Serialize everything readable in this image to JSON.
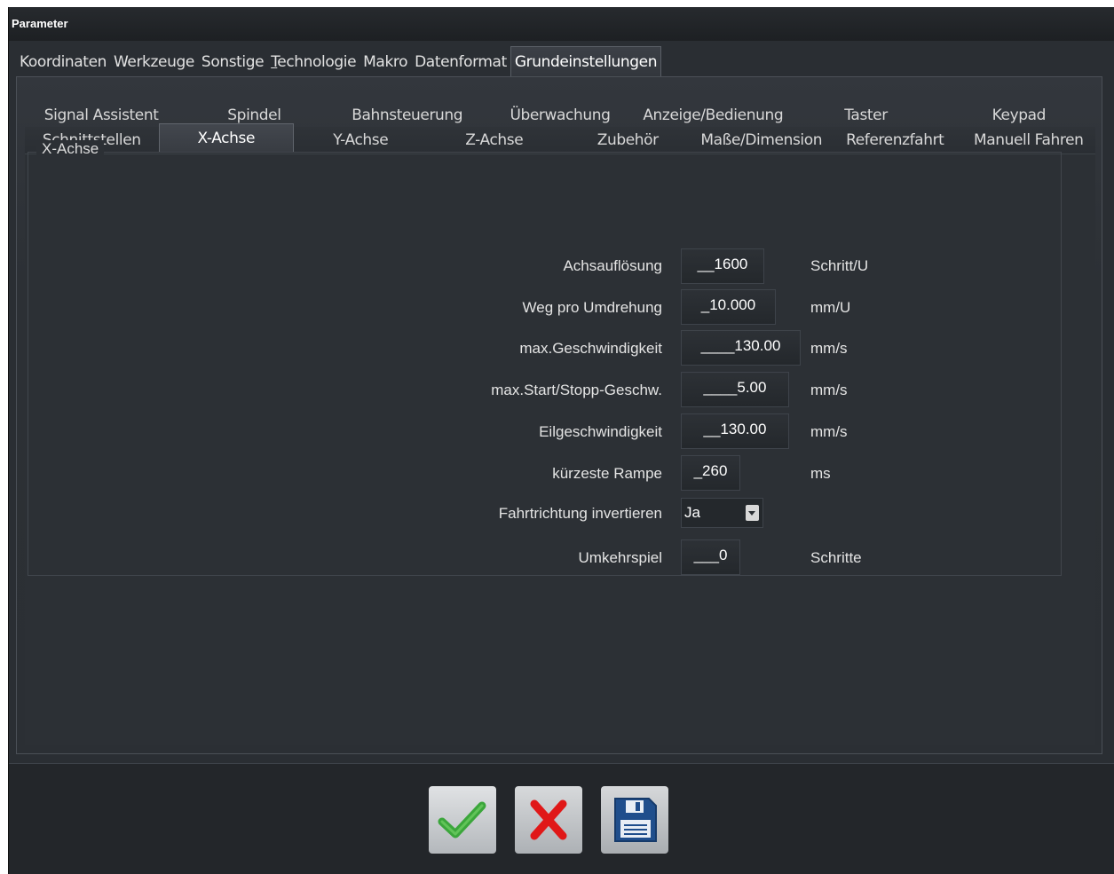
{
  "window": {
    "title": "Parameter"
  },
  "top_tabs": [
    {
      "label": "Koordinaten"
    },
    {
      "label": "Werkzeuge"
    },
    {
      "label": "Sonstige"
    },
    {
      "label_underlined": "T",
      "label_rest": "echnologie"
    },
    {
      "label": "Makro"
    },
    {
      "label": "Datenformat"
    },
    {
      "label": "Grundeinstellungen"
    }
  ],
  "active_top_tab": "Grundeinstellungen",
  "sub_tabs_row1": [
    {
      "label": "Signal Assistent"
    },
    {
      "label": "Spindel"
    },
    {
      "label": "Bahnsteuerung"
    },
    {
      "label": "Überwachung"
    },
    {
      "label": "Anzeige/Bedienung"
    },
    {
      "label": "Taster"
    },
    {
      "label": "Keypad"
    }
  ],
  "sub_tabs_row2": [
    {
      "label": "Schnittstellen"
    },
    {
      "label": "X-Achse"
    },
    {
      "label": "Y-Achse"
    },
    {
      "label": "Z-Achse"
    },
    {
      "label": "Zubehör"
    },
    {
      "label": "Maße/Dimension"
    },
    {
      "label": "Referenzfahrt"
    },
    {
      "label": "Manuell Fahren"
    }
  ],
  "active_sub_tab": "X-Achse",
  "group": {
    "title": "X-Achse",
    "fields": [
      {
        "label": "Achsauflösung",
        "value": "__1600",
        "unit": "Schritt/U"
      },
      {
        "label": "Weg pro Umdrehung",
        "value": "_10.000",
        "unit": "mm/U"
      },
      {
        "label": "max.Geschwindigkeit",
        "value": "____130.00",
        "unit": "mm/s"
      },
      {
        "label": "max.Start/Stopp-Geschw.",
        "value": "____5.00",
        "unit": "mm/s"
      },
      {
        "label": "Eilgeschwindigkeit",
        "value": "__130.00",
        "unit": "mm/s"
      },
      {
        "label": "kürzeste Rampe",
        "value": "_260",
        "unit": "ms"
      },
      {
        "label": "Fahrtrichtung invertieren",
        "select_value": "Ja"
      },
      {
        "label": "Umkehrspiel",
        "value": "___0",
        "unit": "Schritte"
      }
    ]
  },
  "buttons": {
    "ok_icon": "checkmark-icon",
    "cancel_icon": "cross-icon",
    "save_icon": "floppy-disk-icon"
  },
  "colors": {
    "ok_green": "#3ba63b",
    "cancel_red": "#e01818",
    "save_blue": "#1f4e8c"
  }
}
